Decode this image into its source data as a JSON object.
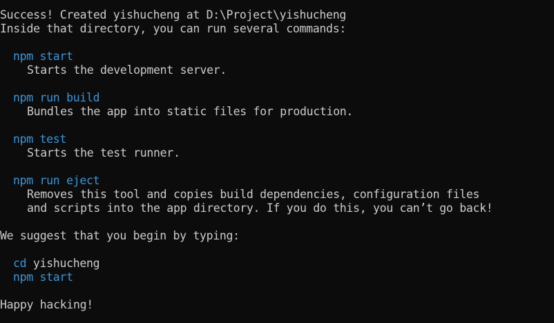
{
  "terminal": {
    "success": "Success! Created yishucheng at D:\\Project\\yishucheng",
    "intro": "Inside that directory, you can run several commands:",
    "commands": [
      {
        "cmd": "npm start",
        "desc": [
          "Starts the development server."
        ]
      },
      {
        "cmd": "npm run build",
        "desc": [
          "Bundles the app into static files for production."
        ]
      },
      {
        "cmd": "npm test",
        "desc": [
          "Starts the test runner."
        ]
      },
      {
        "cmd": "npm run eject",
        "desc": [
          "Removes this tool and copies build dependencies, configuration files",
          "and scripts into the app directory. If you do this, you can’t go back!"
        ]
      }
    ],
    "suggest": "We suggest that you begin by typing:",
    "next_steps": {
      "cd_cmd": "cd",
      "cd_arg": "yishucheng",
      "start_cmd": "npm start"
    },
    "closing": "Happy hacking!"
  },
  "colors": {
    "background": "#0c0c0c",
    "text": "#cccccc",
    "command": "#3a96dd"
  }
}
